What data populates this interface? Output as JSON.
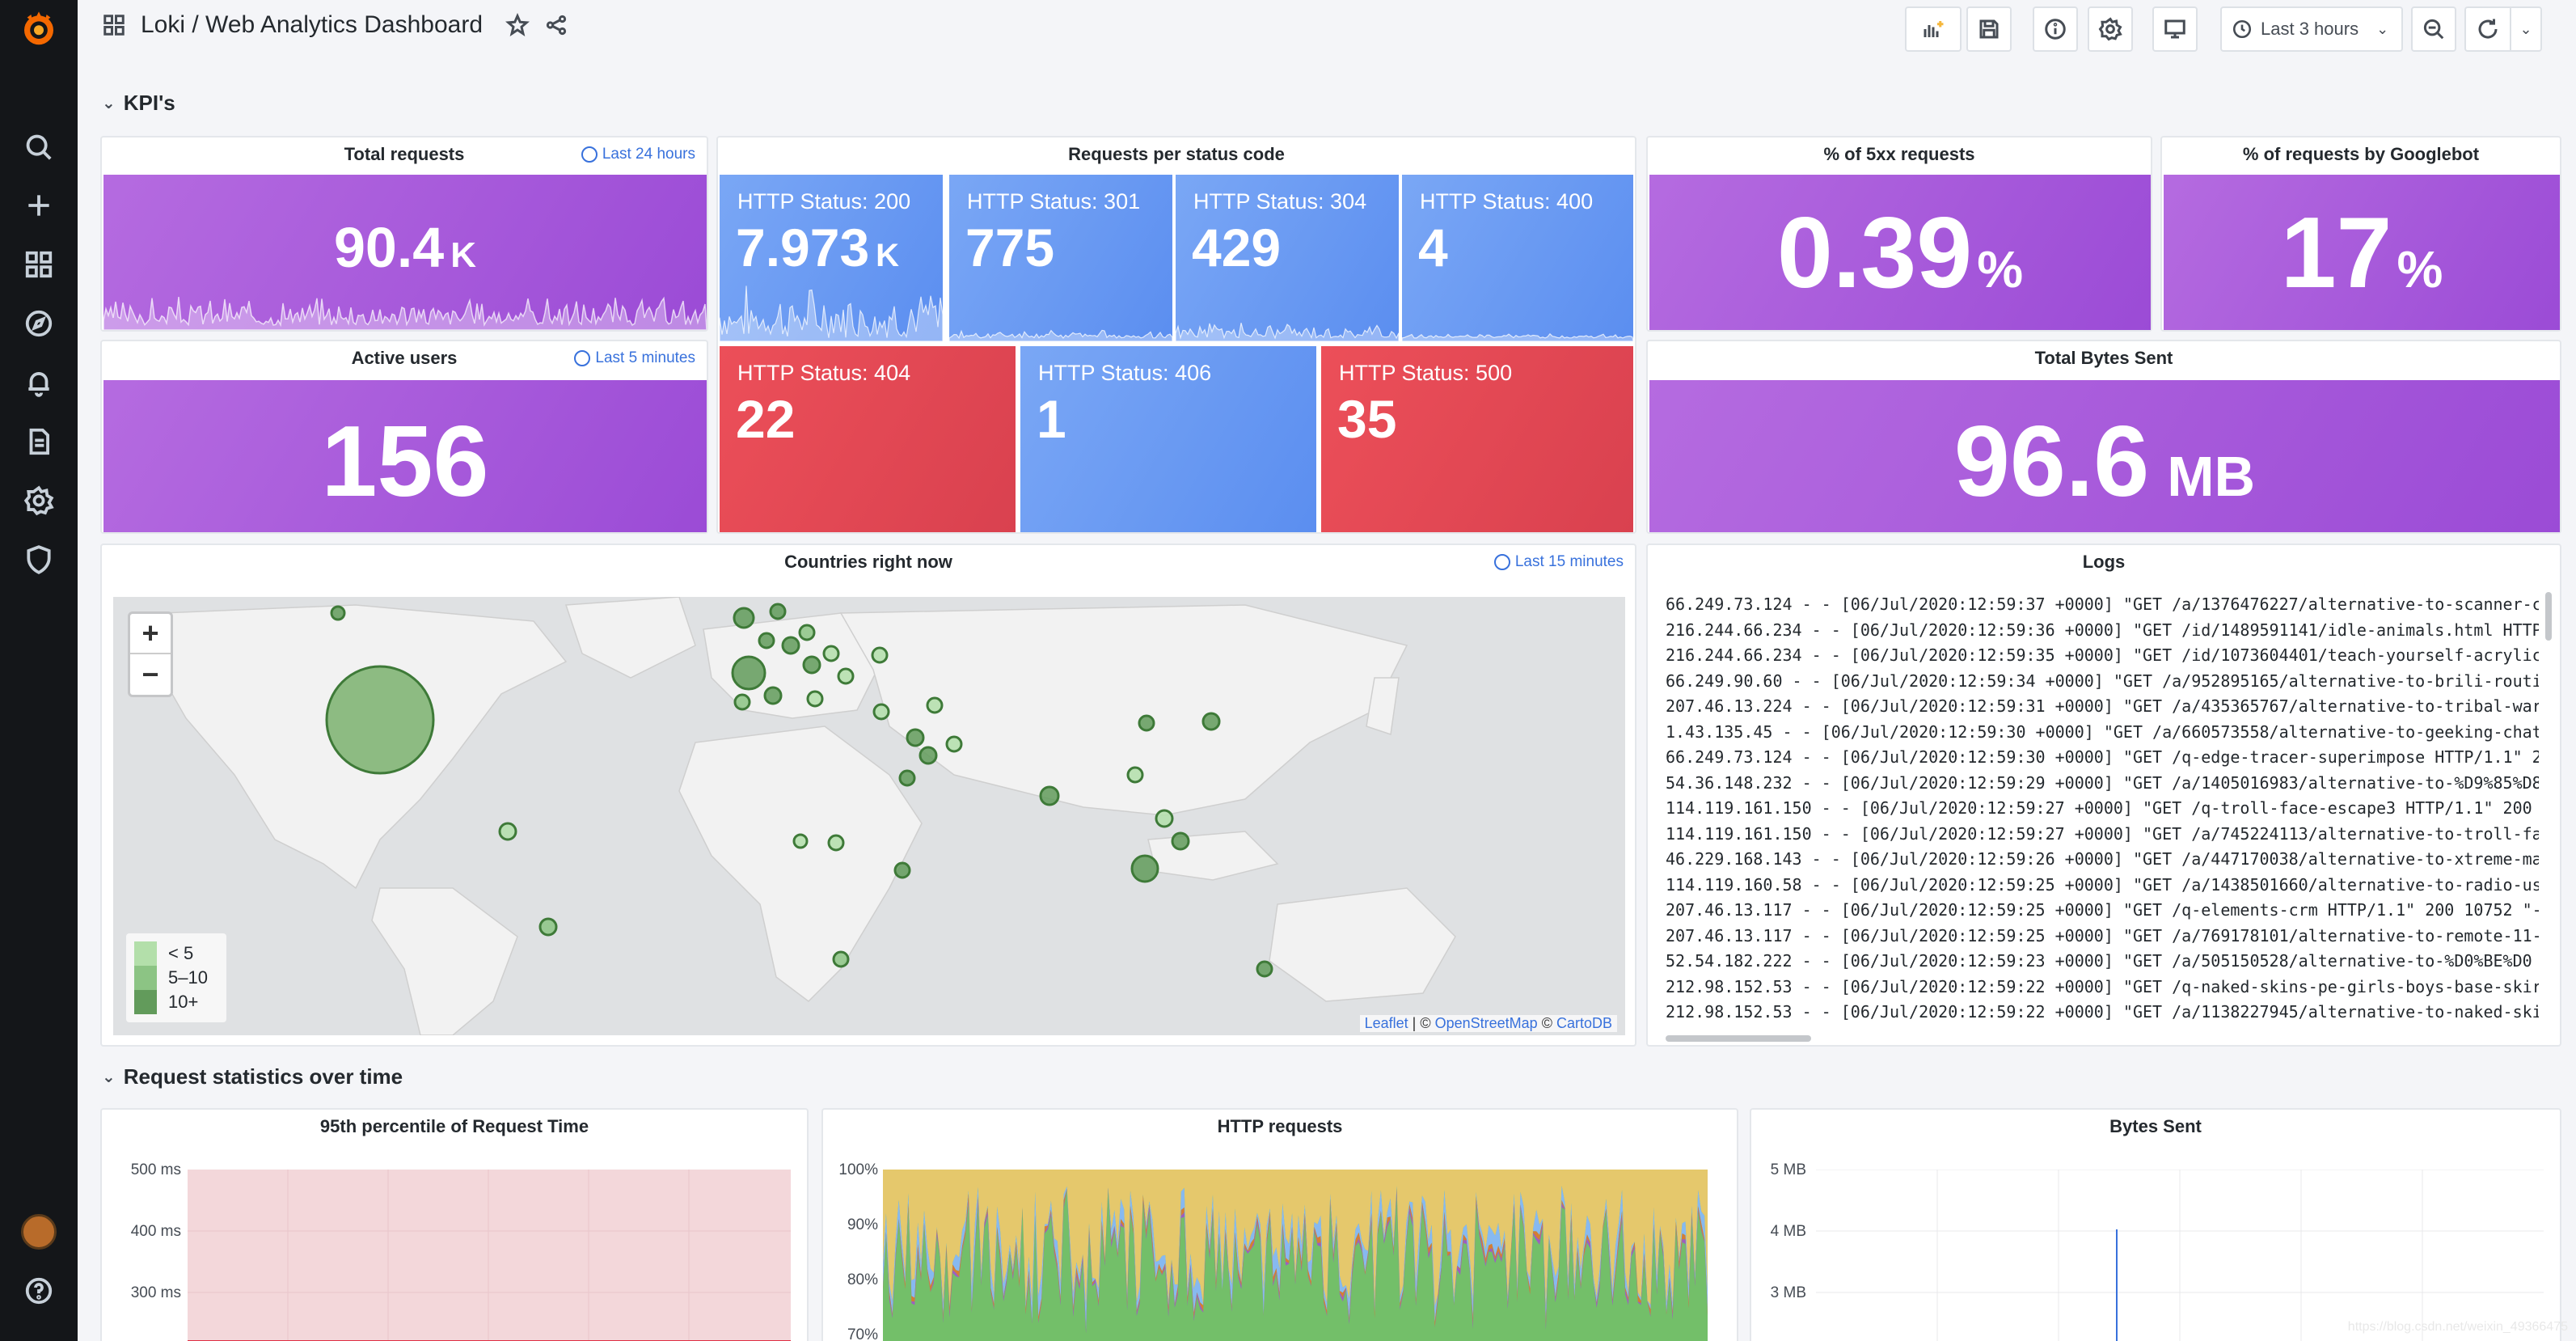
{
  "header": {
    "title": "Loki / Web Analytics Dashboard",
    "time_range": "Last 3 hours"
  },
  "rows": {
    "kpis": "KPI's",
    "stats_over_time": "Request statistics over time"
  },
  "panels": {
    "total_requests": {
      "title": "Total requests",
      "time": "Last 24 hours",
      "value": "90.4",
      "unit": "K"
    },
    "active_users": {
      "title": "Active users",
      "time": "Last 5 minutes",
      "value": "156"
    },
    "status_codes": {
      "title": "Requests per status code",
      "items": [
        {
          "label": "HTTP Status: 200",
          "value": "7.973",
          "unit": "K",
          "color": "blue"
        },
        {
          "label": "HTTP Status: 301",
          "value": "775",
          "unit": "",
          "color": "blue"
        },
        {
          "label": "HTTP Status: 304",
          "value": "429",
          "unit": "",
          "color": "blue"
        },
        {
          "label": "HTTP Status: 400",
          "value": "4",
          "unit": "",
          "color": "blue"
        },
        {
          "label": "HTTP Status: 404",
          "value": "22",
          "unit": "",
          "color": "red"
        },
        {
          "label": "HTTP Status: 406",
          "value": "1",
          "unit": "",
          "color": "blue"
        },
        {
          "label": "HTTP Status: 500",
          "value": "35",
          "unit": "",
          "color": "red"
        }
      ]
    },
    "pct_5xx": {
      "title": "% of 5xx requests",
      "value": "0.39",
      "unit": "%"
    },
    "pct_googlebot": {
      "title": "% of requests by Googlebot",
      "value": "17",
      "unit": "%"
    },
    "total_bytes": {
      "title": "Total Bytes Sent",
      "value": "96.6",
      "unit": "MB"
    },
    "countries": {
      "title": "Countries right now",
      "time": "Last 15 minutes",
      "legend": [
        "< 5",
        "5–10",
        "10+"
      ],
      "attribution_leaflet": "Leaflet",
      "attribution_osm": "OpenStreetMap",
      "attribution_carto": "CartoDB",
      "zoom_in": "+",
      "zoom_out": "−"
    },
    "logs": {
      "title": "Logs",
      "lines": [
        "66.249.73.124 - - [06/Jul/2020:12:59:37 +0000] \"GET /a/1376476227/alternative-to-scanner-c",
        "216.244.66.234 - - [06/Jul/2020:12:59:36 +0000] \"GET /id/1489591141/idle-animals.html HTTP",
        "216.244.66.234 - - [06/Jul/2020:12:59:35 +0000] \"GET /id/1073604401/teach-yourself-acrylic",
        "66.249.90.60 - - [06/Jul/2020:12:59:34 +0000] \"GET /a/952895165/alternative-to-brili-routi",
        "207.46.13.224 - - [06/Jul/2020:12:59:31 +0000] \"GET /a/435365767/alternative-to-tribal-war",
        "1.43.135.45 - - [06/Jul/2020:12:59:30 +0000] \"GET /a/660573558/alternative-to-geeking-chat",
        "66.249.73.124 - - [06/Jul/2020:12:59:30 +0000] \"GET /q-edge-tracer-superimpose HTTP/1.1\" 2",
        "54.36.148.232 - - [06/Jul/2020:12:59:29 +0000] \"GET /a/1405016983/alternative-to-%D9%85%D8",
        "114.119.161.150 - - [06/Jul/2020:12:59:27 +0000] \"GET /q-troll-face-escape3 HTTP/1.1\" 200",
        "114.119.161.150 - - [06/Jul/2020:12:59:27 +0000] \"GET /a/745224113/alternative-to-troll-fa",
        "46.229.168.143 - - [06/Jul/2020:12:59:26 +0000] \"GET /a/447170038/alternative-to-xtreme-ma",
        "114.119.160.58 - - [06/Jul/2020:12:59:25 +0000] \"GET /a/1438501660/alternative-to-radio-us",
        "207.46.13.117 - - [06/Jul/2020:12:59:25 +0000] \"GET /q-elements-crm HTTP/1.1\" 200 10752 \"-",
        "207.46.13.117 - - [06/Jul/2020:12:59:25 +0000] \"GET /a/769178101/alternative-to-remote-11-",
        "52.54.182.222 - - [06/Jul/2020:12:59:23 +0000] \"GET /a/505150528/alternative-to-%D0%BE%D0",
        "212.98.152.53 - - [06/Jul/2020:12:59:22 +0000] \"GET /q-naked-skins-pe-girls-boys-base-skir",
        "212.98.152.53 - - [06/Jul/2020:12:59:22 +0000] \"GET /a/1138227945/alternative-to-naked-ski"
      ]
    },
    "p95": {
      "title": "95th percentile of Request Time",
      "y_labels": [
        "500 ms",
        "400 ms",
        "300 ms"
      ]
    },
    "http_requests": {
      "title": "HTTP requests",
      "y_labels": [
        "100%",
        "90%",
        "80%",
        "70%"
      ]
    },
    "bytes_sent": {
      "title": "Bytes Sent",
      "y_labels": [
        "5 MB",
        "4 MB",
        "3 MB"
      ]
    }
  },
  "watermark": "https://blog.csdn.net/weixin_49366475",
  "colors": {
    "sidebar": "#141619",
    "stat_purple": "#a352cc",
    "stat_blue": "#5794f2",
    "stat_red": "#e02f44",
    "link": "#3871dc",
    "map_dot": "#73bf69"
  }
}
